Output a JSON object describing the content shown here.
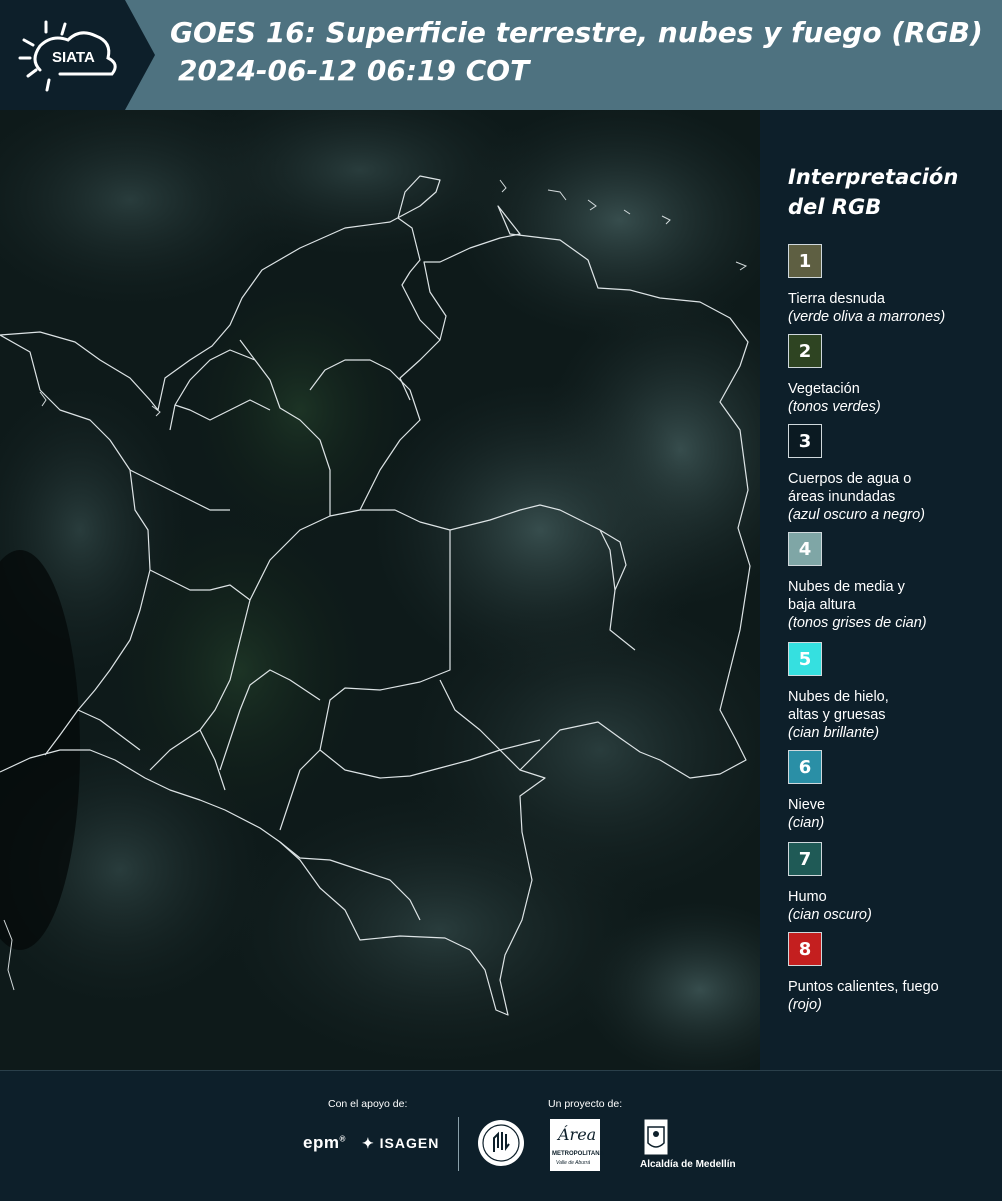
{
  "header": {
    "logo_text": "SIATA",
    "title_line1": "GOES 16: Superficie terrestre, nubes y fuego (RGB)",
    "title_line2": "2024-06-12 06:19 COT"
  },
  "legend": {
    "title_line1": "Interpretación",
    "title_line2": "del RGB",
    "items": [
      {
        "number": "1",
        "label": "Tierra desnuda",
        "desc": "(verde oliva a marrones)",
        "color": "#5e5f42",
        "text_color": "#ffffff"
      },
      {
        "number": "2",
        "label": "Vegetación",
        "desc": "(tonos verdes)",
        "color": "#2e4422",
        "text_color": "#ffffff"
      },
      {
        "number": "3",
        "label": "Cuerpos de agua o\náreas inundadas",
        "desc": "(azul oscuro a negro)",
        "color": "#0b1a22",
        "text_color": "#ffffff"
      },
      {
        "number": "4",
        "label": "Nubes de media y\nbaja altura",
        "desc": "(tonos grises de cian)",
        "color": "#7fa6a6",
        "text_color": "#ffffff"
      },
      {
        "number": "5",
        "label": "Nubes de hielo,\naltas y gruesas",
        "desc": "(cian brillante)",
        "color": "#35e0e0",
        "text_color": "#ffffff"
      },
      {
        "number": "6",
        "label": "Nieve",
        "desc": "(cian)",
        "color": "#2a8fa6",
        "text_color": "#ffffff"
      },
      {
        "number": "7",
        "label": "Humo",
        "desc": "(cian oscuro)",
        "color": "#1f5a56",
        "text_color": "#ffffff"
      },
      {
        "number": "8",
        "label": "Puntos calientes, fuego",
        "desc": "(rojo)",
        "color": "#c41f1f",
        "text_color": "#ffffff"
      }
    ]
  },
  "footer": {
    "support_label": "Con el apoyo de:",
    "project_label": "Un proyecto de:",
    "epm": "epm",
    "isagen": "ISAGEN",
    "metropolitana_name": "Área",
    "metropolitana_sub": "METROPOLITANA",
    "metropolitana_sub2": "Valle de Aburrá",
    "alcaldia": "Alcaldía de Medellín"
  }
}
